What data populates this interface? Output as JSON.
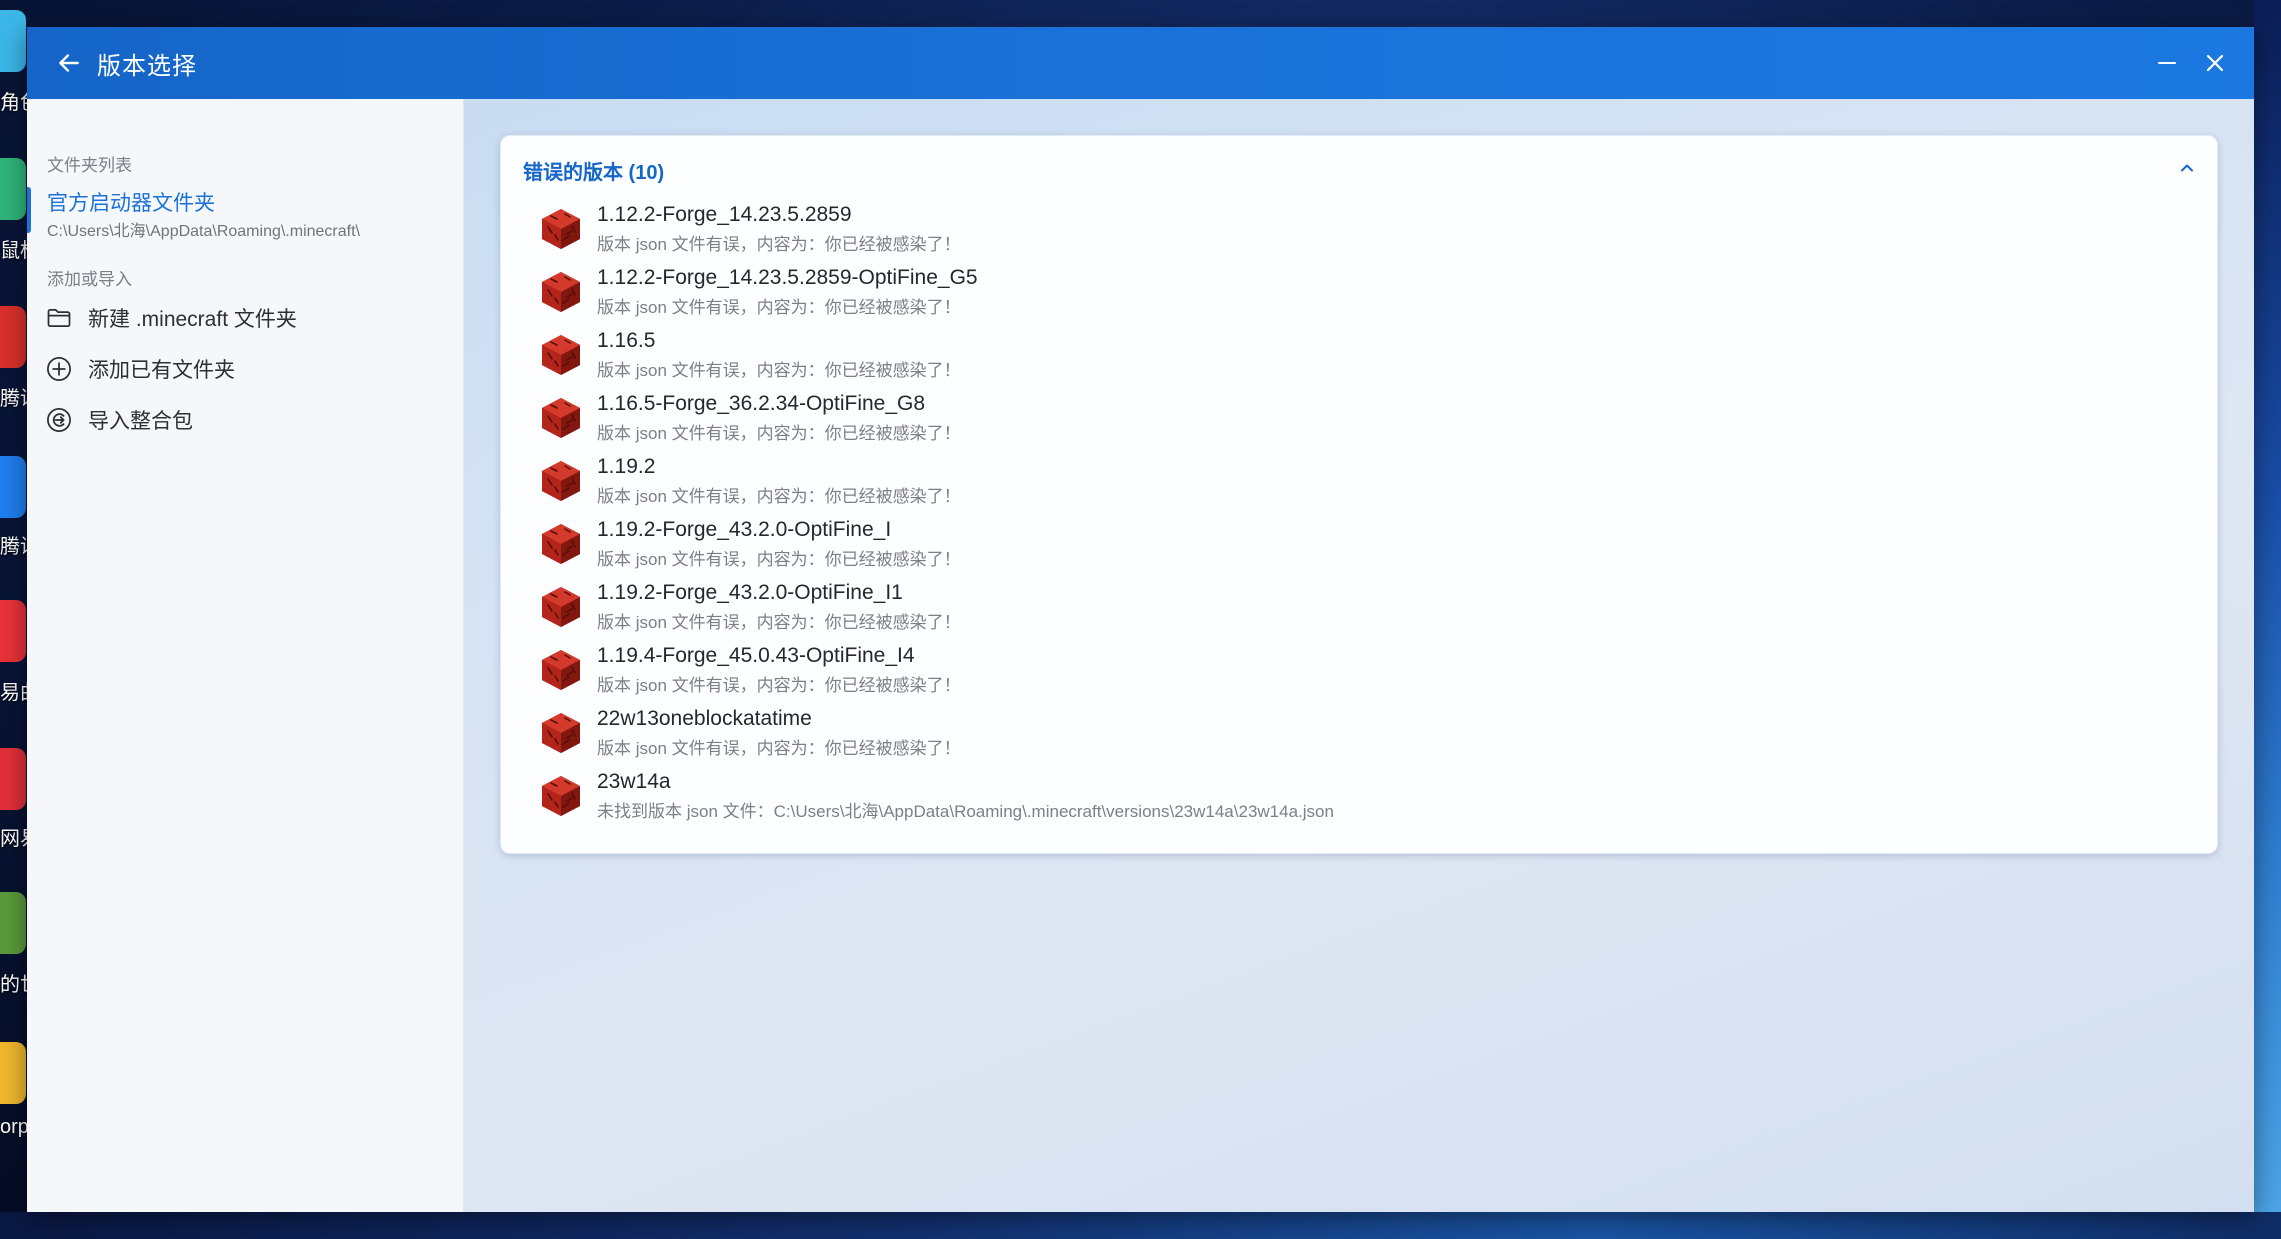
{
  "colors": {
    "accent": "#1a72d8",
    "titlebar": "#1565c8",
    "card_title": "#1566c9",
    "block_red": "#b3241b"
  },
  "desktop": {
    "labels": [
      "角色",
      "鼠标",
      "腾讯",
      "腾讯",
      "易曲",
      "网易",
      "的世",
      "orp"
    ]
  },
  "window": {
    "title": "版本选择",
    "back_icon": "arrow-left-icon",
    "minimize_icon": "minimize-icon",
    "close_icon": "close-icon"
  },
  "sidebar": {
    "folder_list_label": "文件夹列表",
    "folder": {
      "name": "官方启动器文件夹",
      "path": "C:\\Users\\北海\\AppData\\Roaming\\.minecraft\\"
    },
    "add_import_label": "添加或导入",
    "actions": [
      {
        "label": "新建 .minecraft 文件夹",
        "icon": "folder-icon"
      },
      {
        "label": "添加已有文件夹",
        "icon": "add-circle-icon"
      },
      {
        "label": "导入整合包",
        "icon": "import-icon"
      }
    ]
  },
  "main": {
    "card_title": "错误的版本 (10)",
    "collapse_icon": "chevron-up-icon",
    "versions": [
      {
        "name": "1.12.2-Forge_14.23.5.2859",
        "desc": "版本 json 文件有误，内容为：你已经被感染了！"
      },
      {
        "name": "1.12.2-Forge_14.23.5.2859-OptiFine_G5",
        "desc": "版本 json 文件有误，内容为：你已经被感染了！"
      },
      {
        "name": "1.16.5",
        "desc": "版本 json 文件有误，内容为：你已经被感染了！"
      },
      {
        "name": "1.16.5-Forge_36.2.34-OptiFine_G8",
        "desc": "版本 json 文件有误，内容为：你已经被感染了！"
      },
      {
        "name": "1.19.2",
        "desc": "版本 json 文件有误，内容为：你已经被感染了！"
      },
      {
        "name": "1.19.2-Forge_43.2.0-OptiFine_I",
        "desc": "版本 json 文件有误，内容为：你已经被感染了！"
      },
      {
        "name": "1.19.2-Forge_43.2.0-OptiFine_I1",
        "desc": "版本 json 文件有误，内容为：你已经被感染了！"
      },
      {
        "name": "1.19.4-Forge_45.0.43-OptiFine_I4",
        "desc": "版本 json 文件有误，内容为：你已经被感染了！"
      },
      {
        "name": "22w13oneblockatatime",
        "desc": "版本 json 文件有误，内容为：你已经被感染了！"
      },
      {
        "name": "23w14a",
        "desc": "未找到版本 json 文件：C:\\Users\\北海\\AppData\\Roaming\\.minecraft\\versions\\23w14a\\23w14a.json"
      }
    ]
  }
}
